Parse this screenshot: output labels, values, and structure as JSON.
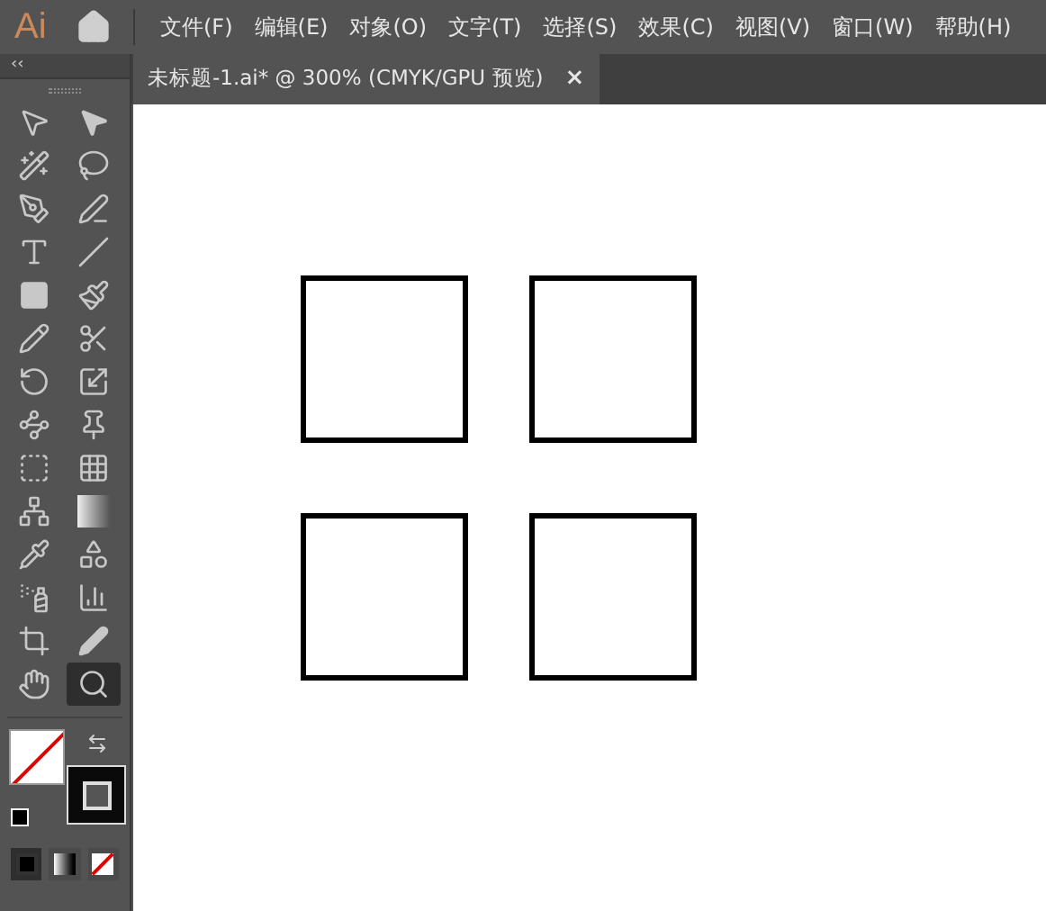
{
  "app": {
    "logo": "Ai"
  },
  "menu": [
    "文件(F)",
    "编辑(E)",
    "对象(O)",
    "文字(T)",
    "选择(S)",
    "效果(C)",
    "视图(V)",
    "窗口(W)",
    "帮助(H)"
  ],
  "panel": {
    "collapse": "‹‹"
  },
  "tabs": [
    {
      "label": "未标题-1.ai* @ 300% (CMYK/GPU 预览)",
      "close": "×",
      "selected": true
    }
  ],
  "tools": [
    {
      "selected": false
    },
    {
      "selected": false
    },
    {
      "selected": false
    },
    {
      "selected": false
    },
    {
      "selected": false
    },
    {
      "selected": false
    },
    {
      "selected": false
    },
    {
      "selected": false
    },
    {
      "selected": false
    },
    {
      "selected": false
    },
    {
      "selected": false
    },
    {
      "selected": false
    },
    {
      "selected": false
    },
    {
      "selected": false
    },
    {
      "selected": false
    },
    {
      "selected": false
    },
    {
      "selected": false
    },
    {
      "selected": false
    },
    {
      "selected": false
    },
    {
      "selected": false
    },
    {
      "selected": false
    },
    {
      "selected": false
    },
    {
      "selected": false
    },
    {
      "selected": false
    },
    {
      "selected": false
    },
    {
      "selected": false
    },
    {
      "selected": false
    },
    {
      "selected": true
    }
  ],
  "draw_modes": [
    {
      "selected": true
    },
    {
      "selected": false
    },
    {
      "selected": false
    }
  ],
  "artboard": {
    "shapes": [
      {
        "kind": "square"
      },
      {
        "kind": "square"
      },
      {
        "kind": "square"
      },
      {
        "kind": "square"
      }
    ]
  }
}
